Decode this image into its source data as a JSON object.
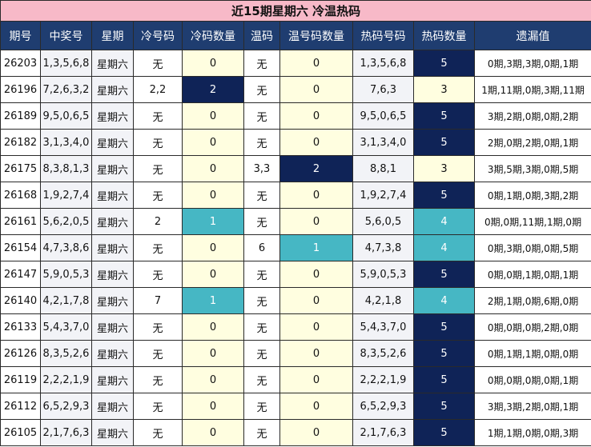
{
  "title": "近15期星期六 冷温热码",
  "headers": [
    "期号",
    "中奖号",
    "星期",
    "冷号码",
    "冷码数量",
    "温码",
    "温号码数量",
    "热码号码",
    "热码数量",
    "遗漏值"
  ],
  "colors": {
    "title_bg": "#f7b9c8",
    "header_bg": "#1f3d70",
    "count_high": "#0f2357",
    "count_mid": "#46b7c4",
    "count_base": "#fffee0"
  },
  "rows": [
    {
      "period": "26203",
      "numbers": "1,3,5,6,8",
      "weekday": "星期六",
      "cold": "无",
      "cold_count": "0",
      "warm": "无",
      "warm_count": "0",
      "hot": "1,3,5,6,8",
      "hot_count": "5",
      "miss": "0期,3期,3期,0期,1期"
    },
    {
      "period": "26196",
      "numbers": "7,2,6,3,2",
      "weekday": "星期六",
      "cold": "2,2",
      "cold_count": "2",
      "warm": "无",
      "warm_count": "0",
      "hot": "7,6,3",
      "hot_count": "3",
      "miss": "1期,11期,0期,3期,11期"
    },
    {
      "period": "26189",
      "numbers": "9,5,0,6,5",
      "weekday": "星期六",
      "cold": "无",
      "cold_count": "0",
      "warm": "无",
      "warm_count": "0",
      "hot": "9,5,0,6,5",
      "hot_count": "5",
      "miss": "3期,2期,0期,0期,2期"
    },
    {
      "period": "26182",
      "numbers": "3,1,3,4,0",
      "weekday": "星期六",
      "cold": "无",
      "cold_count": "0",
      "warm": "无",
      "warm_count": "0",
      "hot": "3,1,3,4,0",
      "hot_count": "5",
      "miss": "2期,0期,2期,0期,1期"
    },
    {
      "period": "26175",
      "numbers": "8,3,8,1,3",
      "weekday": "星期六",
      "cold": "无",
      "cold_count": "0",
      "warm": "3,3",
      "warm_count": "2",
      "hot": "8,8,1",
      "hot_count": "3",
      "miss": "3期,5期,3期,0期,5期"
    },
    {
      "period": "26168",
      "numbers": "1,9,2,7,4",
      "weekday": "星期六",
      "cold": "无",
      "cold_count": "0",
      "warm": "无",
      "warm_count": "0",
      "hot": "1,9,2,7,4",
      "hot_count": "5",
      "miss": "0期,1期,0期,3期,2期"
    },
    {
      "period": "26161",
      "numbers": "5,6,2,0,5",
      "weekday": "星期六",
      "cold": "2",
      "cold_count": "1",
      "warm": "无",
      "warm_count": "0",
      "hot": "5,6,0,5",
      "hot_count": "4",
      "miss": "0期,0期,11期,1期,0期"
    },
    {
      "period": "26154",
      "numbers": "4,7,3,8,6",
      "weekday": "星期六",
      "cold": "无",
      "cold_count": "0",
      "warm": "6",
      "warm_count": "1",
      "hot": "4,7,3,8",
      "hot_count": "4",
      "miss": "0期,3期,0期,0期,5期"
    },
    {
      "period": "26147",
      "numbers": "5,9,0,5,3",
      "weekday": "星期六",
      "cold": "无",
      "cold_count": "0",
      "warm": "无",
      "warm_count": "0",
      "hot": "5,9,0,5,3",
      "hot_count": "5",
      "miss": "0期,0期,1期,0期,1期"
    },
    {
      "period": "26140",
      "numbers": "4,2,1,7,8",
      "weekday": "星期六",
      "cold": "7",
      "cold_count": "1",
      "warm": "无",
      "warm_count": "0",
      "hot": "4,2,1,8",
      "hot_count": "4",
      "miss": "2期,1期,0期,6期,0期"
    },
    {
      "period": "26133",
      "numbers": "5,4,3,7,0",
      "weekday": "星期六",
      "cold": "无",
      "cold_count": "0",
      "warm": "无",
      "warm_count": "0",
      "hot": "5,4,3,7,0",
      "hot_count": "5",
      "miss": "0期,0期,0期,2期,0期"
    },
    {
      "period": "26126",
      "numbers": "8,3,5,2,6",
      "weekday": "星期六",
      "cold": "无",
      "cold_count": "0",
      "warm": "无",
      "warm_count": "0",
      "hot": "8,3,5,2,6",
      "hot_count": "5",
      "miss": "0期,1期,1期,0期,0期"
    },
    {
      "period": "26119",
      "numbers": "2,2,2,1,9",
      "weekday": "星期六",
      "cold": "无",
      "cold_count": "0",
      "warm": "无",
      "warm_count": "0",
      "hot": "2,2,2,1,9",
      "hot_count": "5",
      "miss": "0期,0期,0期,0期,1期"
    },
    {
      "period": "26112",
      "numbers": "6,5,2,9,3",
      "weekday": "星期六",
      "cold": "无",
      "cold_count": "0",
      "warm": "无",
      "warm_count": "0",
      "hot": "6,5,2,9,3",
      "hot_count": "5",
      "miss": "3期,3期,2期,0期,1期"
    },
    {
      "period": "26105",
      "numbers": "2,1,7,6,3",
      "weekday": "星期六",
      "cold": "无",
      "cold_count": "0",
      "warm": "无",
      "warm_count": "0",
      "hot": "2,1,7,6,3",
      "hot_count": "5",
      "miss": "1期,1期,0期,0期,3期"
    }
  ]
}
